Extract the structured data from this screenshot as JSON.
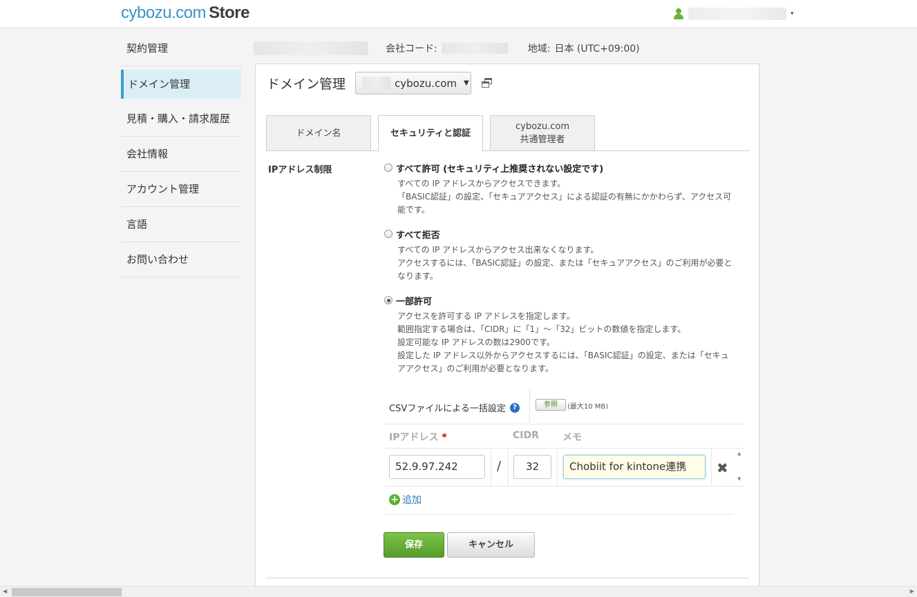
{
  "header": {
    "logo_part1": "cybozu.com",
    "logo_part2": "Store",
    "user_caret": "▾"
  },
  "sidebar": {
    "items": [
      {
        "label": "契約管理"
      },
      {
        "label": "ドメイン管理"
      },
      {
        "label": "見積・購入・請求履歴"
      },
      {
        "label": "会社情報"
      },
      {
        "label": "アカウント管理"
      },
      {
        "label": "言語"
      },
      {
        "label": "お問い合わせ"
      }
    ]
  },
  "infobar": {
    "company_code_label": "会社コード:",
    "region_label": "地域:",
    "region_value": "日本 (UTC+09:00)"
  },
  "panel": {
    "title": "ドメイン管理",
    "domain_value": "cybozu.com",
    "domain_caret": "▼",
    "tabs": [
      {
        "label": "ドメイン名"
      },
      {
        "label": "セキュリティと認証"
      },
      {
        "label_line1": "cybozu.com",
        "label_line2": "共通管理者"
      }
    ]
  },
  "ip_restriction": {
    "label": "IPアドレス制限",
    "options": [
      {
        "title": "すべて許可 (セキュリティ上推奨されない設定です)",
        "desc": [
          "すべての IP アドレスからアクセスできます。",
          "「BASIC認証」の設定、「セキュアアクセス」による認証の有無にかかわらず、アクセス可",
          "能です。"
        ]
      },
      {
        "title": "すべて拒否",
        "desc": [
          "すべての IP アドレスからアクセス出来なくなります。",
          "アクセスするには、「BASIC認証」の設定、または「セキュアアクセス」のご利用が必要と",
          "なります。"
        ]
      },
      {
        "title": "一部許可",
        "desc": [
          "アクセスを許可する IP アドレスを指定します。",
          "範囲指定する場合は、「CIDR」に「1」〜「32」ビットの数値を指定します。",
          "設定可能な IP アドレスの数は2900です。",
          "設定した IP アドレス以外からアクセスするには、「BASIC認証」の設定、または「セキュ",
          "アアクセス」のご利用が必要となります。"
        ]
      }
    ],
    "selected_option": "一部許可",
    "csv_label": "CSVファイルによる一括設定",
    "help_icon": "?",
    "browse_label": "参照",
    "max_size": "(最大10 MB)",
    "columns": {
      "ip": "IPアドレス",
      "required_mark": "*",
      "cidr": "CIDR",
      "memo": "メモ"
    },
    "rows": [
      {
        "ip": "52.9.97.242",
        "separator": "/",
        "cidr": "32",
        "memo": "Chobiit for kintone連携"
      }
    ],
    "delete_icon": "✖",
    "add_icon": "+",
    "add_label": "追加",
    "save_label": "保存",
    "cancel_label": "キャンセル"
  },
  "colors": {
    "accent_blue": "#3aa0d0",
    "save_green": "#559c2b",
    "logo_blue": "#3a93c8",
    "link_blue": "#2a7ac0"
  }
}
